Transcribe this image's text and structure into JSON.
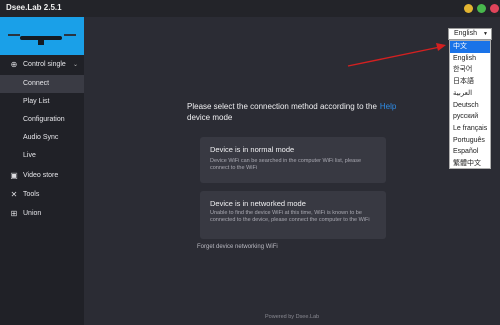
{
  "window": {
    "title": "Dsee.Lab 2.5.1",
    "controls": [
      "minimize-icon",
      "maximize-icon",
      "close-icon"
    ],
    "colors": {
      "minimize": "#e3b531",
      "maximize": "#48b84c",
      "close": "#e0445a"
    }
  },
  "sidebar": {
    "banner_color": "#1aa0e8",
    "group": {
      "label": "Control single",
      "icon": "gamepad-icon",
      "chevron": "chevron-down-icon"
    },
    "subitems": [
      {
        "label": "Connect",
        "active": true
      },
      {
        "label": "Play List",
        "active": false
      },
      {
        "label": "Configuration",
        "active": false
      },
      {
        "label": "Audio Sync",
        "active": false
      },
      {
        "label": "Live",
        "active": false
      }
    ],
    "items": [
      {
        "label": "Video store",
        "icon": "video-icon"
      },
      {
        "label": "Tools",
        "icon": "tools-icon"
      },
      {
        "label": "Union",
        "icon": "union-icon"
      }
    ]
  },
  "main": {
    "prompt": "Please select the connection method according to the",
    "help_link": "Help",
    "prompt_tail": "device mode",
    "cards": [
      {
        "title": "Device is in normal mode",
        "description": "Device WiFi can be searched in the computer WiFi list, please connect to the WiFi"
      },
      {
        "title": "Device is in networked mode",
        "description": "Unable to find the device WiFi at this time, WiFi is known to be connected to the device, please connect the computer to the WiFi"
      }
    ],
    "forget_link": "Forget device networking WiFi",
    "footer": "Powered by Dsee.Lab"
  },
  "language": {
    "selected": "English",
    "options": [
      "中文",
      "English",
      "한국어",
      "日本語",
      "العربية",
      "Deutsch",
      "русский",
      "Le français",
      "Português",
      "Español",
      "繁體中文"
    ],
    "highlighted": "中文",
    "accent": "#1a73e8"
  },
  "annotation_arrow_color": "#d42020"
}
